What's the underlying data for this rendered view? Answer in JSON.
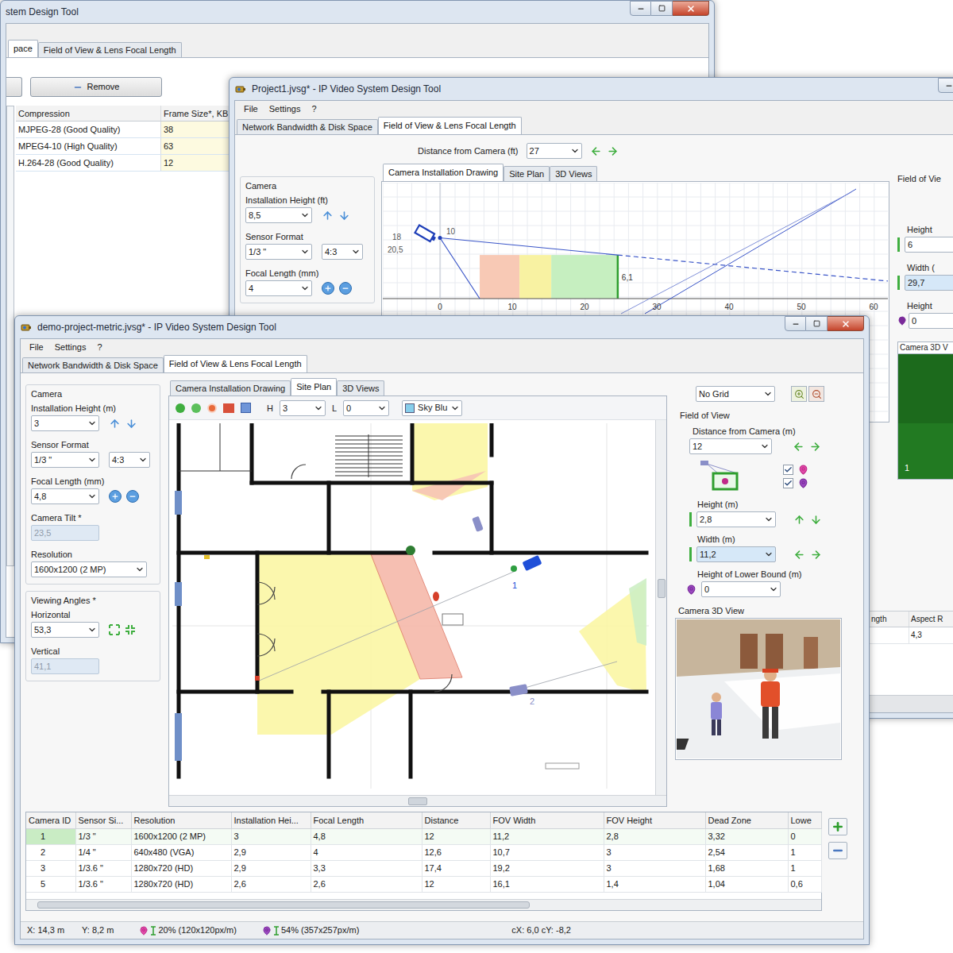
{
  "back_window": {
    "title": "stem Design Tool",
    "tabs": [
      {
        "label": "pace",
        "selected": true
      },
      {
        "label": "Field of View & Lens Focal Length",
        "selected": false
      }
    ],
    "remove_button": "Remove",
    "table": {
      "columns": [
        "Compression",
        "Frame Size*, KB"
      ],
      "rows": [
        [
          "MJPEG-28 (Good Quality)",
          "38"
        ],
        [
          "MPEG4-10 (High Quality)",
          "63"
        ],
        [
          "H.264-28 (Good Quality)",
          "12"
        ]
      ]
    }
  },
  "middle_window": {
    "title": "Project1.jvsg* - IP Video System Design Tool",
    "menu": [
      "File",
      "Settings",
      "?"
    ],
    "tabs": [
      {
        "label": "Network Bandwidth & Disk Space",
        "selected": false
      },
      {
        "label": "Field of View & Lens Focal Length",
        "selected": true
      }
    ],
    "distance": {
      "label": "Distance from Camera (ft)",
      "value": "27"
    },
    "camera": {
      "legend": "Camera",
      "installation_height": {
        "label": "Installation Height (ft)",
        "value": "8,5"
      },
      "sensor_format": {
        "label": "Sensor Format",
        "value": "1/3 \"",
        "aspect": "4:3"
      },
      "focal_length": {
        "label": "Focal Length (mm)",
        "value": "4"
      }
    },
    "view_tabs": [
      {
        "label": "Camera Installation Drawing",
        "selected": true
      },
      {
        "label": "Site Plan",
        "selected": false
      },
      {
        "label": "3D Views",
        "selected": false
      }
    ],
    "drawing": {
      "x_ticks": [
        "0",
        "10",
        "20",
        "30",
        "40",
        "50",
        "60"
      ],
      "camera_height_ft": 8.5,
      "target_height_ft": 6.1,
      "labels": [
        "10",
        "18",
        "20,5"
      ],
      "target_label": "6,1",
      "zones": [
        {
          "from_ft": 5.5,
          "to_ft": 11,
          "color": "#f8c9b5"
        },
        {
          "from_ft": 11,
          "to_ft": 15.4,
          "color": "#f8f2a2"
        },
        {
          "from_ft": 15.4,
          "to_ft": 24.6,
          "color": "#c6efc0"
        }
      ]
    },
    "field_of_view": {
      "legend": "Field of Vie",
      "height": {
        "label": "Height",
        "value": "6"
      },
      "width": {
        "label": "Width (",
        "value": "29,7"
      },
      "lower": {
        "label": "Height",
        "value": "0"
      }
    },
    "camera_3d": {
      "label": "Camera 3D V",
      "marker": "1"
    },
    "table": {
      "columns": [
        "ngth",
        "Aspect R"
      ],
      "rows": [
        [
          "",
          "4,3"
        ]
      ]
    }
  },
  "front_window": {
    "title": "demo-project-metric.jvsg* - IP Video System Design Tool",
    "menu": [
      "File",
      "Settings",
      "?"
    ],
    "tabs": [
      {
        "label": "Network Bandwidth & Disk Space",
        "selected": false
      },
      {
        "label": "Field of View & Lens Focal Length",
        "selected": true
      }
    ],
    "camera": {
      "legend": "Camera",
      "installation_height": {
        "label": "Installation Height (m)",
        "value": "3"
      },
      "sensor_format": {
        "label": "Sensor Format",
        "value": "1/3 \"",
        "aspect": "4:3"
      },
      "focal_length": {
        "label": "Focal Length (mm)",
        "value": "4,8"
      },
      "tilt": {
        "label": "Camera Tilt *",
        "value": "23,5",
        "disabled": true
      },
      "resolution": {
        "label": "Resolution",
        "value": "1600x1200 (2 MP)"
      }
    },
    "viewing_angles": {
      "legend": "Viewing Angles *",
      "horizontal": {
        "label": "Horizontal",
        "value": "53,3",
        "disabled": false
      },
      "vertical": {
        "label": "Vertical",
        "value": "41,1",
        "disabled": true
      }
    },
    "view_tabs": [
      {
        "label": "Camera Installation Drawing",
        "selected": false
      },
      {
        "label": "Site Plan",
        "selected": true
      },
      {
        "label": "3D Views",
        "selected": false
      }
    ],
    "toolbar": {
      "h_label": "H",
      "h_value": "3",
      "l_label": "L",
      "l_value": "0",
      "color": "Sky Blu"
    },
    "site_plan": {
      "cameras": [
        {
          "label": "1",
          "color": "#1f4fd8"
        },
        {
          "label": "2",
          "color": "#8a8fc8"
        }
      ]
    },
    "grid": "No Grid",
    "field_of_view": {
      "legend": "Field of View",
      "distance": {
        "label": "Distance from Camera (m)",
        "value": "12"
      },
      "checkboxes": [
        {
          "checked": true
        },
        {
          "checked": true
        }
      ],
      "height": {
        "label": "Height (m)",
        "value": "2,8"
      },
      "width": {
        "label": "Width (m)",
        "value": "11,2"
      },
      "lower": {
        "label": "Height of Lower Bound (m)",
        "value": "0"
      }
    },
    "camera_3d": {
      "label": "Camera 3D View"
    },
    "table": {
      "columns": [
        "Camera ID",
        "Sensor Si...",
        "Resolution",
        "Installation Hei...",
        "Focal Length",
        "Distance",
        "FOV Width",
        "FOV Height",
        "Dead Zone",
        "Lowe"
      ],
      "rows": [
        {
          "cells": [
            "1",
            "1/3 \"",
            "1600x1200 (2 MP)",
            "3",
            "4,8",
            "12",
            "11,2",
            "2,8",
            "3,32",
            "0"
          ],
          "selected": true
        },
        {
          "cells": [
            "2",
            "1/4 \"",
            "640x480 (VGA)",
            "2,9",
            "4",
            "12,6",
            "10,7",
            "3",
            "2,54",
            "1"
          ],
          "selected": false
        },
        {
          "cells": [
            "3",
            "1/3.6 \"",
            "1280x720 (HD)",
            "2,9",
            "3,3",
            "17,4",
            "19,2",
            "3",
            "1,68",
            "1"
          ],
          "selected": false
        },
        {
          "cells": [
            "5",
            "1/3.6 \"",
            "1280x720 (HD)",
            "2,6",
            "2,6",
            "12",
            "16,1",
            "1,4",
            "1,04",
            "0,6"
          ],
          "selected": false
        }
      ]
    },
    "status_bar": {
      "x": "X: 14,3 m",
      "y": "Y: 8,2 m",
      "items": [
        "20% (120x120px/m)",
        "54% (357x257px/m)"
      ],
      "cursor": "cX: 6,0 cY: -8,2"
    }
  }
}
